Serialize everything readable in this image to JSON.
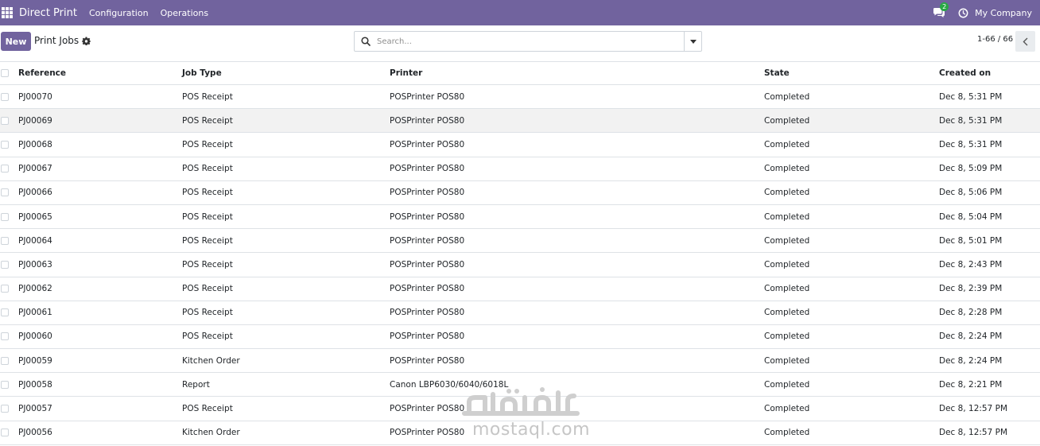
{
  "navbar": {
    "app_name": "Direct Print",
    "menu": [
      "Configuration",
      "Operations"
    ],
    "chat_badge": "2",
    "company": "My Company",
    "bg_color": "#71639e"
  },
  "control": {
    "new_label": "New",
    "breadcrumb": "Print Jobs",
    "search_placeholder": "Search...",
    "pager_value": "1-66 / 66"
  },
  "table": {
    "columns": [
      "Reference",
      "Job Type",
      "Printer",
      "State",
      "Created on"
    ],
    "rows": [
      [
        "PJ00070",
        "POS Receipt",
        "POSPrinter POS80",
        "Completed",
        "Dec 8, 5:31 PM"
      ],
      [
        "PJ00069",
        "POS Receipt",
        "POSPrinter POS80",
        "Completed",
        "Dec 8, 5:31 PM"
      ],
      [
        "PJ00068",
        "POS Receipt",
        "POSPrinter POS80",
        "Completed",
        "Dec 8, 5:31 PM"
      ],
      [
        "PJ00067",
        "POS Receipt",
        "POSPrinter POS80",
        "Completed",
        "Dec 8, 5:09 PM"
      ],
      [
        "PJ00066",
        "POS Receipt",
        "POSPrinter POS80",
        "Completed",
        "Dec 8, 5:06 PM"
      ],
      [
        "PJ00065",
        "POS Receipt",
        "POSPrinter POS80",
        "Completed",
        "Dec 8, 5:04 PM"
      ],
      [
        "PJ00064",
        "POS Receipt",
        "POSPrinter POS80",
        "Completed",
        "Dec 8, 5:01 PM"
      ],
      [
        "PJ00063",
        "POS Receipt",
        "POSPrinter POS80",
        "Completed",
        "Dec 8, 2:43 PM"
      ],
      [
        "PJ00062",
        "POS Receipt",
        "POSPrinter POS80",
        "Completed",
        "Dec 8, 2:39 PM"
      ],
      [
        "PJ00061",
        "POS Receipt",
        "POSPrinter POS80",
        "Completed",
        "Dec 8, 2:28 PM"
      ],
      [
        "PJ00060",
        "POS Receipt",
        "POSPrinter POS80",
        "Completed",
        "Dec 8, 2:24 PM"
      ],
      [
        "PJ00059",
        "Kitchen Order",
        "POSPrinter POS80",
        "Completed",
        "Dec 8, 2:24 PM"
      ],
      [
        "PJ00058",
        "Report",
        "Canon LBP6030/6040/6018L",
        "Completed",
        "Dec 8, 2:21 PM"
      ],
      [
        "PJ00057",
        "POS Receipt",
        "POSPrinter POS80",
        "Completed",
        "Dec 8, 12:57 PM"
      ],
      [
        "PJ00056",
        "Kitchen Order",
        "POSPrinter POS80",
        "Completed",
        "Dec 8, 12:57 PM"
      ]
    ]
  },
  "watermark": {
    "latin": "mostaql.com",
    "arabic": "مستقل"
  }
}
